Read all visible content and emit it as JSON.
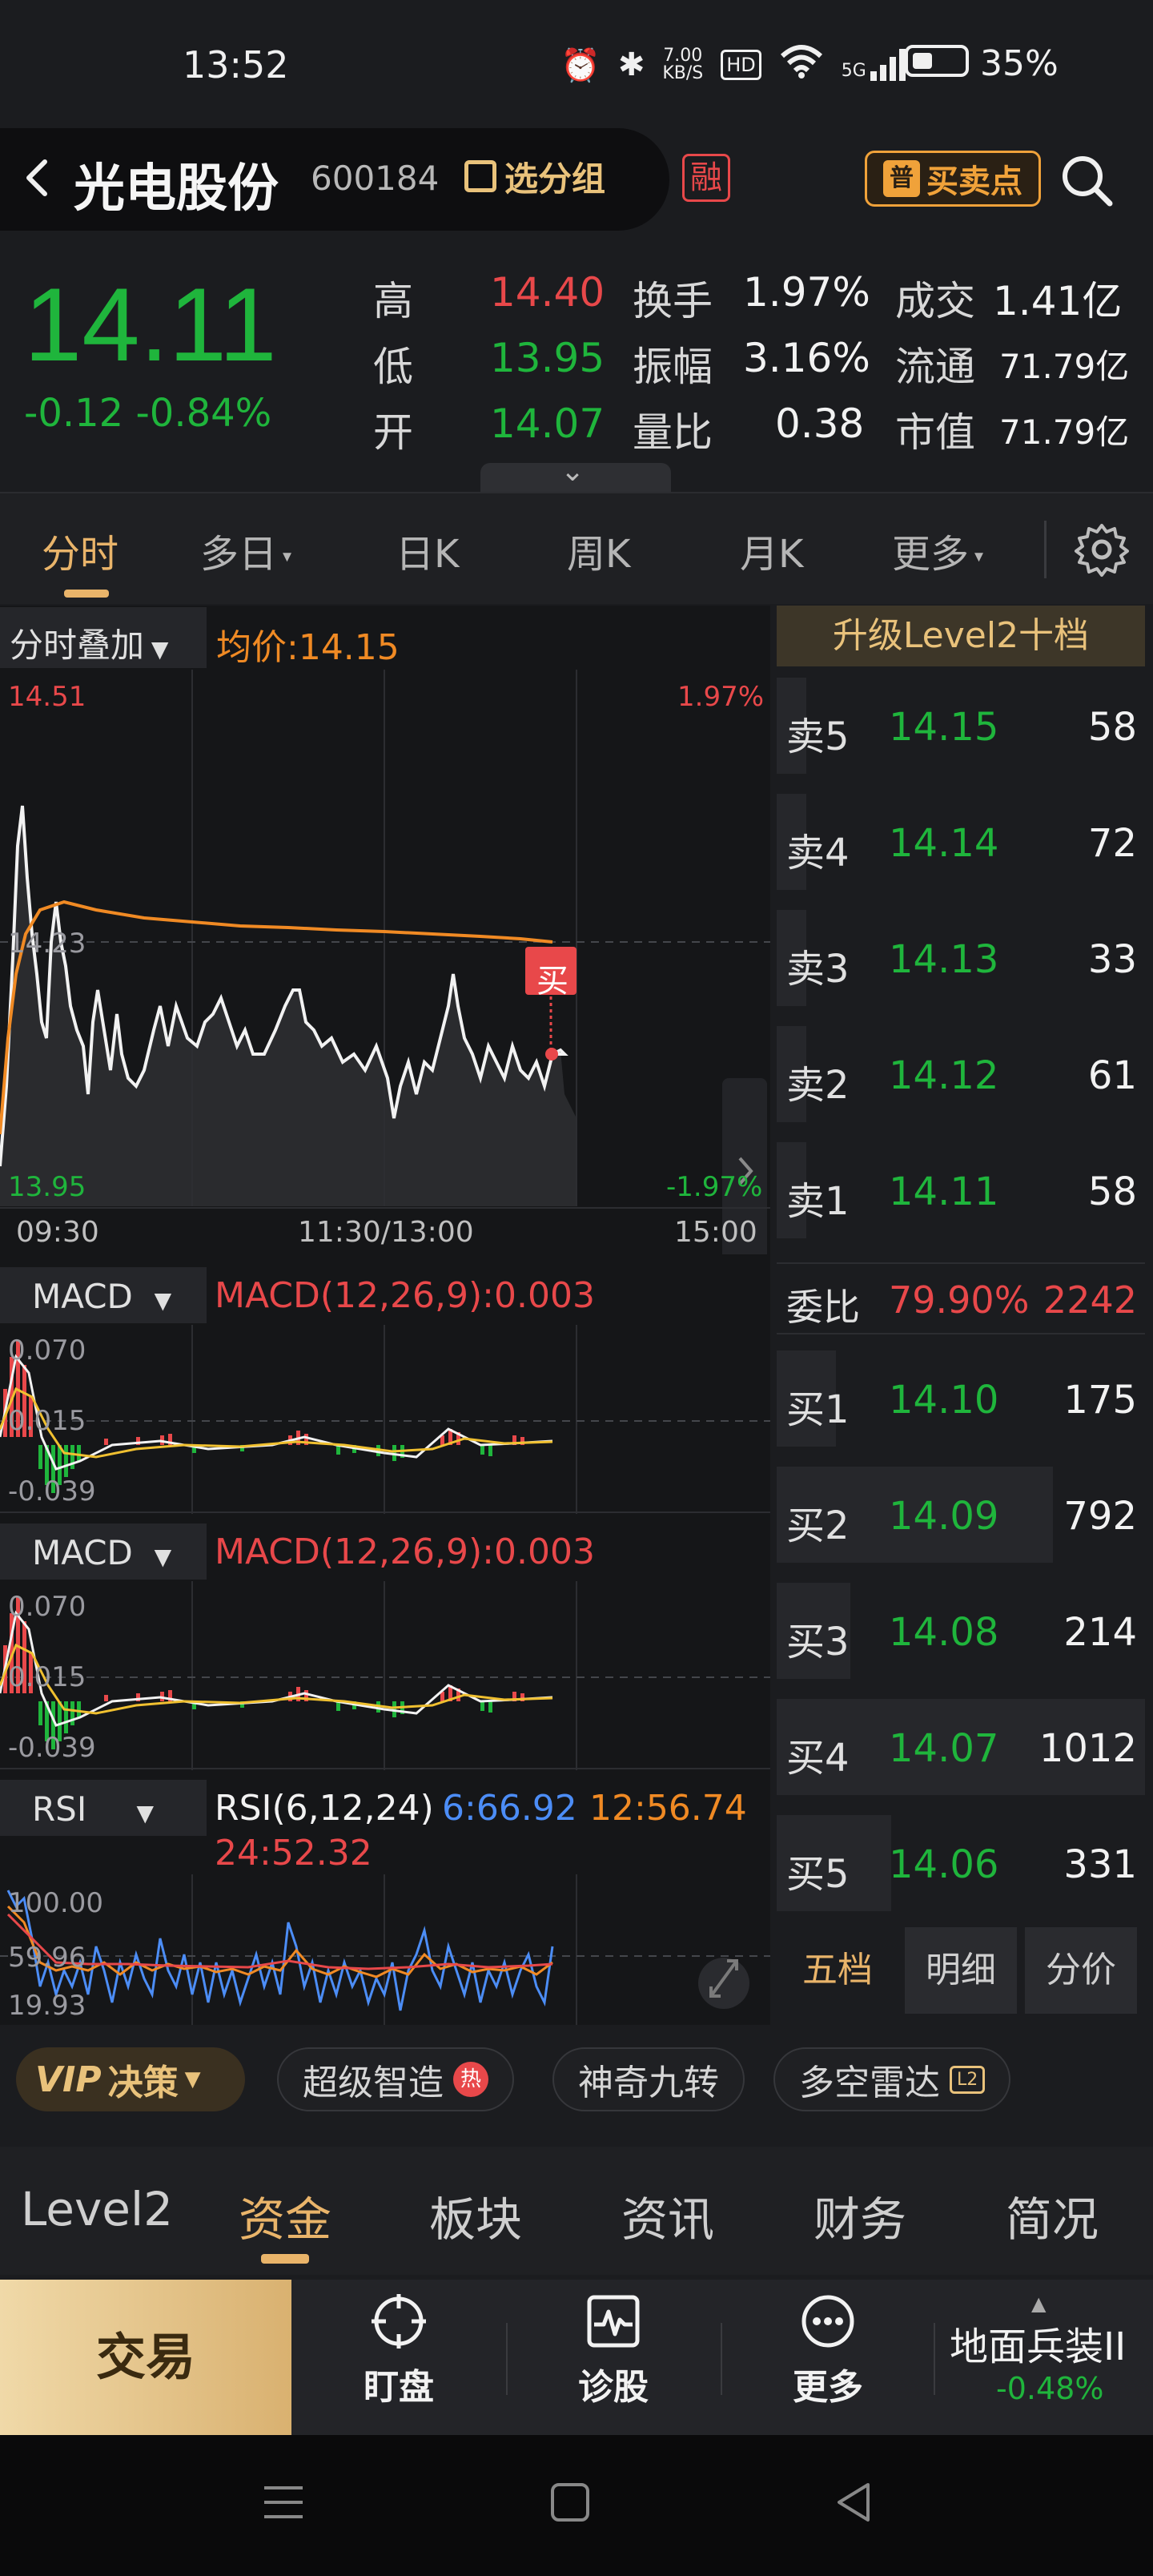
{
  "status_bar": {
    "time": "13:52",
    "net_speed_top": "7.00",
    "net_speed_unit": "KB/S",
    "hd": "HD",
    "signal": "5G",
    "battery": "35%"
  },
  "header": {
    "stock_name": "光电股份",
    "stock_code": "600184",
    "group_label": "选分组",
    "rong_badge": "融",
    "buysell_icon": "普",
    "buysell_label": "买卖点"
  },
  "quote": {
    "price": "14.11",
    "change": "-0.12 -0.84%",
    "high_label": "高",
    "high": "14.40",
    "low_label": "低",
    "low": "13.95",
    "open_label": "开",
    "open": "14.07",
    "turnover_label": "换手",
    "turnover": "1.97%",
    "amplitude_label": "振幅",
    "amplitude": "3.16%",
    "volratio_label": "量比",
    "volratio": "0.38",
    "amount_label": "成交",
    "amount": "1.41亿",
    "float_label": "流通",
    "float": "71.79亿",
    "mcap_label": "市值",
    "mcap": "71.79亿"
  },
  "kline_tabs": {
    "fenshi": "分时",
    "multi_day": "多日",
    "day": "日K",
    "week": "周K",
    "month": "月K",
    "more": "更多"
  },
  "chart": {
    "overlay_label": "分时叠加",
    "avg_price": "均价:14.15",
    "y_top": "14.51",
    "y_mid": "14.23",
    "y_bottom": "13.95",
    "pct_top": "1.97%",
    "pct_bottom": "-1.97%",
    "t_start": "09:30",
    "t_mid": "11:30/13:00",
    "t_end": "15:00",
    "buy_marker": "买"
  },
  "macd1": {
    "label": "MACD",
    "value": "MACD(12,26,9):0.003",
    "y_top": "0.070",
    "y_mid": "0.015",
    "y_bottom": "-0.039"
  },
  "macd2": {
    "label": "MACD",
    "value": "MACD(12,26,9):0.003",
    "y_top": "0.070",
    "y_mid": "0.015",
    "y_bottom": "-0.039"
  },
  "rsi": {
    "label": "RSI",
    "params": "RSI(6,12,24)",
    "rsi6": "6:66.92",
    "rsi12": "12:56.74",
    "rsi24": "24:52.32",
    "y_top": "100.00",
    "y_mid": "59.96",
    "y_bottom": "19.93"
  },
  "order_book": {
    "banner": "升级Level2十档",
    "asks": [
      {
        "label": "卖5",
        "price": "14.15",
        "vol": "58",
        "depth": 0.03
      },
      {
        "label": "卖4",
        "price": "14.14",
        "vol": "72",
        "depth": 0.03
      },
      {
        "label": "卖3",
        "price": "14.13",
        "vol": "33",
        "depth": 0.02
      },
      {
        "label": "卖2",
        "price": "14.12",
        "vol": "61",
        "depth": 0.03
      },
      {
        "label": "卖1",
        "price": "14.11",
        "vol": "58",
        "depth": 0.03
      }
    ],
    "ratio_label": "委比",
    "ratio_pct": "79.90%",
    "ratio_vol": "2242",
    "bids": [
      {
        "label": "买1",
        "price": "14.10",
        "vol": "175",
        "depth": 0.16
      },
      {
        "label": "买2",
        "price": "14.09",
        "vol": "792",
        "depth": 0.75
      },
      {
        "label": "买3",
        "price": "14.08",
        "vol": "214",
        "depth": 0.2
      },
      {
        "label": "买4",
        "price": "14.07",
        "vol": "1012",
        "depth": 1.0
      },
      {
        "label": "买5",
        "price": "14.06",
        "vol": "331",
        "depth": 0.31
      }
    ],
    "tabs": [
      "五档",
      "明细",
      "分价"
    ]
  },
  "functions": {
    "vip": "决策",
    "vip_prefix": "VIP",
    "super": "超级智造",
    "hot_badge": "热",
    "magic": "神奇九转",
    "radar": "多空雷达",
    "l2_badge": "L2"
  },
  "section_tabs": [
    "Level2",
    "资金",
    "板块",
    "资讯",
    "财务",
    "简况"
  ],
  "action_bar": {
    "trade": "交易",
    "watch": "盯盘",
    "diagnose": "诊股",
    "more": "更多",
    "sector_name": "地面兵装II",
    "sector_change": "-0.48%"
  },
  "colors": {
    "up": "#e8484a",
    "down": "#1fb53c",
    "accent": "#e9b46a",
    "avg_line": "#f08a24"
  }
}
